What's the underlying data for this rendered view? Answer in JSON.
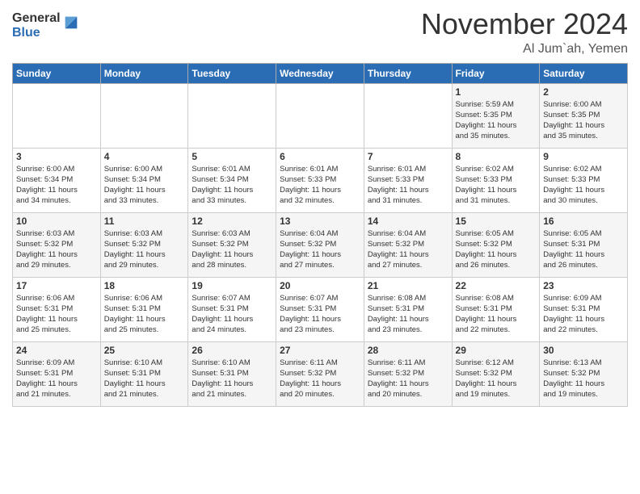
{
  "header": {
    "logo": {
      "general": "General",
      "blue": "Blue"
    },
    "month": "November 2024",
    "location": "Al Jum`ah, Yemen"
  },
  "weekdays": [
    "Sunday",
    "Monday",
    "Tuesday",
    "Wednesday",
    "Thursday",
    "Friday",
    "Saturday"
  ],
  "weeks": [
    [
      {
        "day": "",
        "info": ""
      },
      {
        "day": "",
        "info": ""
      },
      {
        "day": "",
        "info": ""
      },
      {
        "day": "",
        "info": ""
      },
      {
        "day": "",
        "info": ""
      },
      {
        "day": "1",
        "info": "Sunrise: 5:59 AM\nSunset: 5:35 PM\nDaylight: 11 hours\nand 35 minutes."
      },
      {
        "day": "2",
        "info": "Sunrise: 6:00 AM\nSunset: 5:35 PM\nDaylight: 11 hours\nand 35 minutes."
      }
    ],
    [
      {
        "day": "3",
        "info": "Sunrise: 6:00 AM\nSunset: 5:34 PM\nDaylight: 11 hours\nand 34 minutes."
      },
      {
        "day": "4",
        "info": "Sunrise: 6:00 AM\nSunset: 5:34 PM\nDaylight: 11 hours\nand 33 minutes."
      },
      {
        "day": "5",
        "info": "Sunrise: 6:01 AM\nSunset: 5:34 PM\nDaylight: 11 hours\nand 33 minutes."
      },
      {
        "day": "6",
        "info": "Sunrise: 6:01 AM\nSunset: 5:33 PM\nDaylight: 11 hours\nand 32 minutes."
      },
      {
        "day": "7",
        "info": "Sunrise: 6:01 AM\nSunset: 5:33 PM\nDaylight: 11 hours\nand 31 minutes."
      },
      {
        "day": "8",
        "info": "Sunrise: 6:02 AM\nSunset: 5:33 PM\nDaylight: 11 hours\nand 31 minutes."
      },
      {
        "day": "9",
        "info": "Sunrise: 6:02 AM\nSunset: 5:33 PM\nDaylight: 11 hours\nand 30 minutes."
      }
    ],
    [
      {
        "day": "10",
        "info": "Sunrise: 6:03 AM\nSunset: 5:32 PM\nDaylight: 11 hours\nand 29 minutes."
      },
      {
        "day": "11",
        "info": "Sunrise: 6:03 AM\nSunset: 5:32 PM\nDaylight: 11 hours\nand 29 minutes."
      },
      {
        "day": "12",
        "info": "Sunrise: 6:03 AM\nSunset: 5:32 PM\nDaylight: 11 hours\nand 28 minutes."
      },
      {
        "day": "13",
        "info": "Sunrise: 6:04 AM\nSunset: 5:32 PM\nDaylight: 11 hours\nand 27 minutes."
      },
      {
        "day": "14",
        "info": "Sunrise: 6:04 AM\nSunset: 5:32 PM\nDaylight: 11 hours\nand 27 minutes."
      },
      {
        "day": "15",
        "info": "Sunrise: 6:05 AM\nSunset: 5:32 PM\nDaylight: 11 hours\nand 26 minutes."
      },
      {
        "day": "16",
        "info": "Sunrise: 6:05 AM\nSunset: 5:31 PM\nDaylight: 11 hours\nand 26 minutes."
      }
    ],
    [
      {
        "day": "17",
        "info": "Sunrise: 6:06 AM\nSunset: 5:31 PM\nDaylight: 11 hours\nand 25 minutes."
      },
      {
        "day": "18",
        "info": "Sunrise: 6:06 AM\nSunset: 5:31 PM\nDaylight: 11 hours\nand 25 minutes."
      },
      {
        "day": "19",
        "info": "Sunrise: 6:07 AM\nSunset: 5:31 PM\nDaylight: 11 hours\nand 24 minutes."
      },
      {
        "day": "20",
        "info": "Sunrise: 6:07 AM\nSunset: 5:31 PM\nDaylight: 11 hours\nand 23 minutes."
      },
      {
        "day": "21",
        "info": "Sunrise: 6:08 AM\nSunset: 5:31 PM\nDaylight: 11 hours\nand 23 minutes."
      },
      {
        "day": "22",
        "info": "Sunrise: 6:08 AM\nSunset: 5:31 PM\nDaylight: 11 hours\nand 22 minutes."
      },
      {
        "day": "23",
        "info": "Sunrise: 6:09 AM\nSunset: 5:31 PM\nDaylight: 11 hours\nand 22 minutes."
      }
    ],
    [
      {
        "day": "24",
        "info": "Sunrise: 6:09 AM\nSunset: 5:31 PM\nDaylight: 11 hours\nand 21 minutes."
      },
      {
        "day": "25",
        "info": "Sunrise: 6:10 AM\nSunset: 5:31 PM\nDaylight: 11 hours\nand 21 minutes."
      },
      {
        "day": "26",
        "info": "Sunrise: 6:10 AM\nSunset: 5:31 PM\nDaylight: 11 hours\nand 21 minutes."
      },
      {
        "day": "27",
        "info": "Sunrise: 6:11 AM\nSunset: 5:32 PM\nDaylight: 11 hours\nand 20 minutes."
      },
      {
        "day": "28",
        "info": "Sunrise: 6:11 AM\nSunset: 5:32 PM\nDaylight: 11 hours\nand 20 minutes."
      },
      {
        "day": "29",
        "info": "Sunrise: 6:12 AM\nSunset: 5:32 PM\nDaylight: 11 hours\nand 19 minutes."
      },
      {
        "day": "30",
        "info": "Sunrise: 6:13 AM\nSunset: 5:32 PM\nDaylight: 11 hours\nand 19 minutes."
      }
    ]
  ]
}
